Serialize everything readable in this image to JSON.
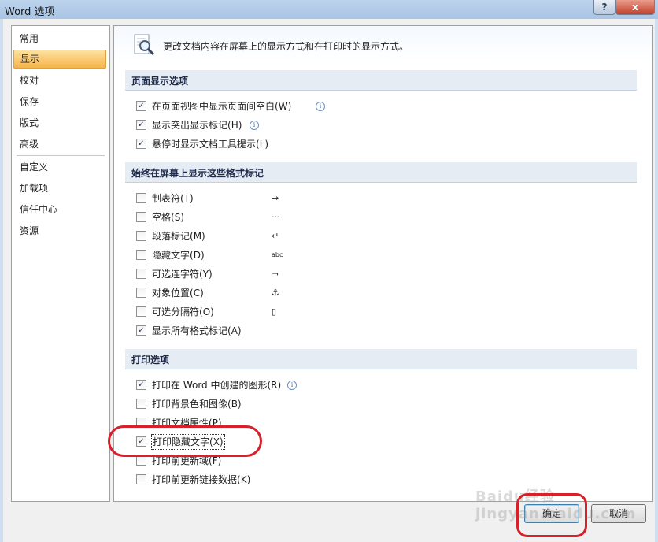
{
  "window": {
    "title": "Word 选项",
    "help_glyph": "?",
    "close_glyph": "x"
  },
  "nav": {
    "items": [
      {
        "label": "常用"
      },
      {
        "label": "显示",
        "selected": true
      },
      {
        "label": "校对"
      },
      {
        "label": "保存"
      },
      {
        "label": "版式"
      },
      {
        "label": "高级"
      },
      {
        "label": "自定义"
      },
      {
        "label": "加载项"
      },
      {
        "label": "信任中心"
      },
      {
        "label": "资源"
      }
    ]
  },
  "header": {
    "text": "更改文档内容在屏幕上的显示方式和在打印时的显示方式。",
    "icon": "magnifier-document-icon"
  },
  "sections": {
    "page_display": {
      "title": "页面显示选项",
      "options": [
        {
          "label": "在页面视图中显示页面间空白",
          "hotkey": "(W)",
          "checked": true,
          "info": true
        },
        {
          "label": "显示突出显示标记",
          "hotkey": "(H)",
          "checked": true,
          "info": true
        },
        {
          "label": "悬停时显示文档工具提示",
          "hotkey": "(L)",
          "checked": true,
          "info": false
        }
      ]
    },
    "format_marks": {
      "title": "始终在屏幕上显示这些格式标记",
      "options": [
        {
          "label": "制表符",
          "hotkey": "(T)",
          "checked": false,
          "mark": "→"
        },
        {
          "label": "空格",
          "hotkey": "(S)",
          "checked": false,
          "mark": "···"
        },
        {
          "label": "段落标记",
          "hotkey": "(M)",
          "checked": false,
          "mark": "↵"
        },
        {
          "label": "隐藏文字",
          "hotkey": "(D)",
          "checked": false,
          "mark": "abc"
        },
        {
          "label": "可选连字符",
          "hotkey": "(Y)",
          "checked": false,
          "mark": "¬"
        },
        {
          "label": "对象位置",
          "hotkey": "(C)",
          "checked": false,
          "mark": "⚓"
        },
        {
          "label": "可选分隔符",
          "hotkey": "(O)",
          "checked": false,
          "mark": "▯"
        },
        {
          "label": "显示所有格式标记",
          "hotkey": "(A)",
          "checked": true,
          "mark": ""
        }
      ]
    },
    "print": {
      "title": "打印选项",
      "options": [
        {
          "label": "打印在 Word 中创建的图形",
          "hotkey": "(R)",
          "checked": true,
          "info": true
        },
        {
          "label": "打印背景色和图像",
          "hotkey": "(B)",
          "checked": false,
          "info": false
        },
        {
          "label": "打印文档属性",
          "hotkey": "(P)",
          "checked": false,
          "info": false
        },
        {
          "label": "打印隐藏文字",
          "hotkey": "(X)",
          "checked": true,
          "info": false,
          "focused": true
        },
        {
          "label": "打印前更新域",
          "hotkey": "(F)",
          "checked": false,
          "info": false
        },
        {
          "label": "打印前更新链接数据",
          "hotkey": "(K)",
          "checked": false,
          "info": false
        }
      ]
    }
  },
  "buttons": {
    "ok": "确定",
    "cancel": "取消"
  },
  "watermark": "Baidu经验 jingyan.baidu.com",
  "colors": {
    "annotation": "#d8202a",
    "selected_nav": "#f6b44a",
    "section_band": "#e6ecf4"
  }
}
